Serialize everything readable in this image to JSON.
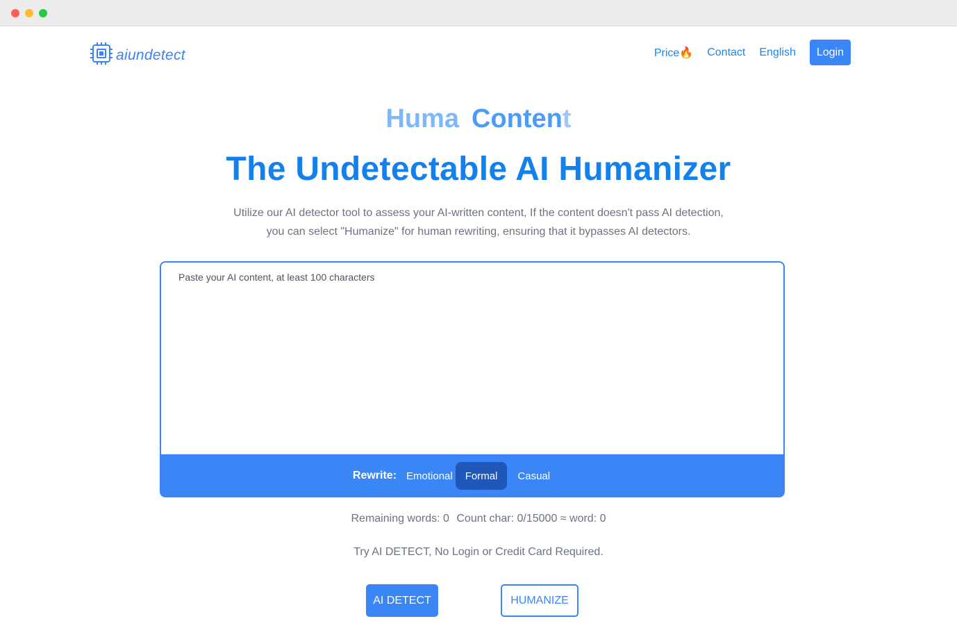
{
  "window": {
    "controls": [
      "close",
      "minimize",
      "maximize"
    ]
  },
  "brand": {
    "name": "aiundetect",
    "icon": "chip-icon",
    "color": "#3b82f6"
  },
  "nav": {
    "price_label": "Price",
    "price_icon": "🔥",
    "contact_label": "Contact",
    "language_label": "English",
    "login_label": "Login"
  },
  "hero": {
    "typing_word1": "Huma",
    "typing_word2_main": "Conten",
    "typing_word2_fade": "t",
    "headline": "The Undetectable AI Humanizer",
    "description": "Utilize our AI detector tool to assess your AI-written content, If the content doesn't pass AI detection, you can select \"Humanize\" for human rewriting, ensuring that it bypasses AI detectors."
  },
  "editor": {
    "placeholder": "Paste your AI content, at least 100 characters",
    "value": ""
  },
  "rewrite": {
    "label": "Rewrite:",
    "options": [
      "Emotional",
      "Formal",
      "Casual"
    ],
    "selected": "Formal"
  },
  "stats": {
    "remaining": "Remaining words: 0",
    "count": "Count char: 0/15000 ≈ word: 0"
  },
  "notice": "Try AI DETECT, No Login or Credit Card Required.",
  "actions": {
    "detect_label": "AI DETECT",
    "humanize_label": "HUMANIZE"
  },
  "colors": {
    "primary": "#3b86f7",
    "heading": "#1380ec",
    "active_option": "#1f58b8"
  }
}
